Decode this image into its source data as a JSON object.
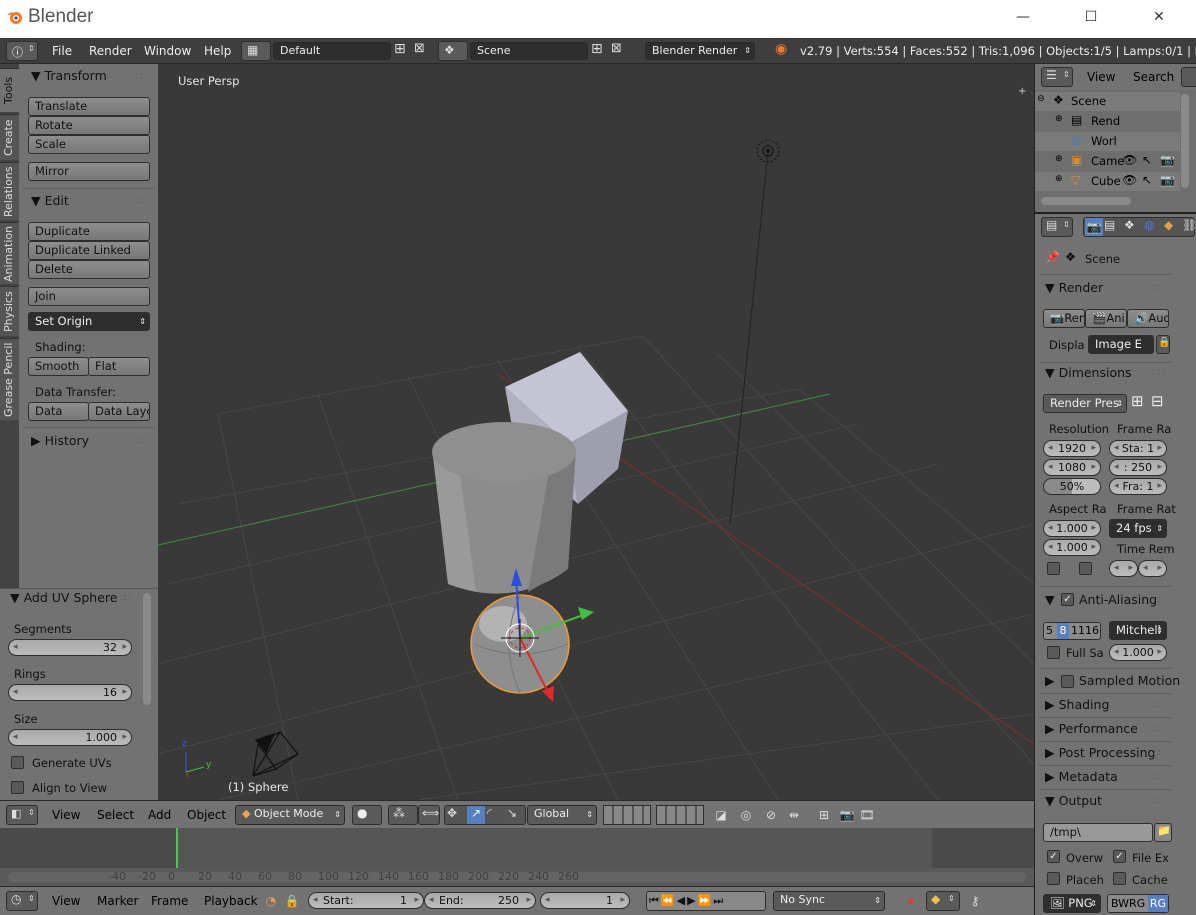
{
  "window": {
    "title": "Blender",
    "minimize": "—",
    "maximize": "☐",
    "close": "✕"
  },
  "info_bar": {
    "menus": [
      "File",
      "Render",
      "Window",
      "Help"
    ],
    "layout": "Default",
    "scene": "Scene",
    "engine": "Blender Render",
    "stats": "v2.79 | Verts:554 | Faces:552 | Tris:1,096 | Objects:1/5 | Lamps:0/1 | Mem:13"
  },
  "tool_tabs": [
    "Tools",
    "Create",
    "Relations",
    "Animation",
    "Physics",
    "Grease Pencil"
  ],
  "tool_shelf": {
    "transform_header": "Transform",
    "transform_buttons": [
      "Translate",
      "Rotate",
      "Scale"
    ],
    "mirror": "Mirror",
    "edit_header": "Edit",
    "edit_buttons": [
      "Duplicate",
      "Duplicate Linked",
      "Delete"
    ],
    "join": "Join",
    "set_origin": "Set Origin",
    "shading_label": "Shading:",
    "smooth": "Smooth",
    "flat": "Flat",
    "data_transfer_label": "Data Transfer:",
    "data": "Data",
    "data_layout": "Data Layo",
    "history_header": "History"
  },
  "redo_panel": {
    "header": "Add UV Sphere",
    "segments_label": "Segments",
    "segments": "32",
    "rings_label": "Rings",
    "rings": "16",
    "size_label": "Size",
    "size": "1.000",
    "generate_uvs": "Generate UVs",
    "align_to_view": "Align to View"
  },
  "viewport": {
    "view_name": "User Persp",
    "object_label": "(1) Sphere",
    "axis_z": "z",
    "axis_y": "y"
  },
  "view3d_header": {
    "menus": [
      "View",
      "Select",
      "Add",
      "Object"
    ],
    "mode": "Object Mode",
    "orientation": "Global"
  },
  "timeline": {
    "ticks": [
      "-40",
      "-20",
      "0",
      "20",
      "40",
      "60",
      "80",
      "100",
      "120",
      "140",
      "160",
      "180",
      "200",
      "220",
      "240",
      "260"
    ],
    "current_frame": 1
  },
  "timeline_header": {
    "menus": [
      "View",
      "Marker",
      "Frame",
      "Playback"
    ],
    "start_label": "Start:",
    "start": "1",
    "end_label": "End:",
    "end": "250",
    "current": "1",
    "sync": "No Sync"
  },
  "outliner": {
    "menus": [
      "View",
      "Search"
    ],
    "items": [
      "Scene",
      "Rend",
      "Worl",
      "Came",
      "Cube"
    ]
  },
  "properties": {
    "context": "Scene",
    "render_header": "Render",
    "render_buttons": [
      "Ren",
      "Ani",
      "Audi"
    ],
    "display_label": "Displa",
    "display_value": "Image E",
    "dimensions_header": "Dimensions",
    "render_presets": "Render Pres",
    "resolution_label": "Resolution",
    "res_x": "1920",
    "res_y": "1080",
    "res_pct": "50%",
    "frame_range_label": "Frame Ra",
    "frame_start": "Sta: 1",
    "frame_end": ": 250",
    "frame_step": "Fra: 1",
    "aspect_label": "Aspect Ra",
    "aspect_x": "1.000",
    "aspect_y": "1.000",
    "frame_rate_label": "Frame Rat",
    "fps": "24 fps",
    "time_remap_label": "Time Rem",
    "aa_header": "Anti-Aliasing",
    "aa_samples": [
      "5",
      "8",
      "11",
      "16"
    ],
    "aa_filter": "Mitchell",
    "full_sample": "Full Sa",
    "aa_size": "1.000",
    "sampled_motion": "Sampled Motion",
    "collapsed_panels": [
      "Shading",
      "Performance",
      "Post Processing",
      "Metadata"
    ],
    "output_header": "Output",
    "output_path": "/tmp\\",
    "overwrite": "Overw",
    "file_ext": "File Ex",
    "placeholders": "Placeh",
    "cache": "Cache",
    "format": "PNG",
    "color_modes": [
      "BW",
      "RG",
      "RG"
    ]
  },
  "colors": {
    "selected_outline": "#f59a2c",
    "x_axis": "#a52a2a",
    "y_axis": "#3a9a3a",
    "header_bg": "#727272",
    "viewport_bg": "#393939"
  }
}
